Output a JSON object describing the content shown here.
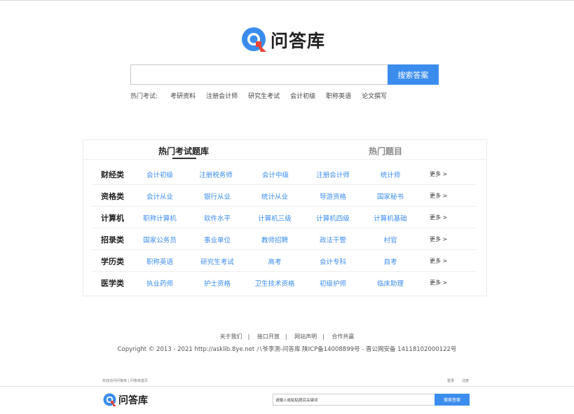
{
  "brand": {
    "name": "问答库"
  },
  "search": {
    "placeholder": "",
    "button": "搜索答案"
  },
  "hot": {
    "label": "热门考试:",
    "links": [
      "考研资料",
      "注册会计师",
      "研究生考试",
      "会计初级",
      "职称英语",
      "论文撰写"
    ]
  },
  "tabs": {
    "active": "热门考试题库",
    "inactive": "热门题目"
  },
  "categories": [
    {
      "name": "财经类",
      "items": [
        "会计初级",
        "注册税务师",
        "会计中级",
        "注册会计师",
        "统计师"
      ]
    },
    {
      "name": "资格类",
      "items": [
        "会计从业",
        "银行从业",
        "统计从业",
        "导游资格",
        "国家秘书"
      ]
    },
    {
      "name": "计算机",
      "items": [
        "职称计算机",
        "软件水平",
        "计算机三级",
        "计算机四级",
        "计算机基础"
      ]
    },
    {
      "name": "招录类",
      "items": [
        "国家公务员",
        "事业单位",
        "教师招聘",
        "政法干警",
        "村官"
      ]
    },
    {
      "name": "学历类",
      "items": [
        "职称英语",
        "研究生考试",
        "高考",
        "会计专科",
        "自考"
      ]
    },
    {
      "name": "医学类",
      "items": [
        "执业药师",
        "护士资格",
        "卫生技术资格",
        "初级护师",
        "临床助理"
      ]
    }
  ],
  "more_label": "更多 >",
  "footer": {
    "links": [
      "关于我们",
      "接口开放",
      "网站声明",
      "合作共赢"
    ],
    "separator": "|",
    "copyright": "Copyright © 2013 - 2021 http://asklib.8ye.net  八爷李测-问答库   陕ICP备14008899号 - 晋公网安备 14118102000122号"
  },
  "bottom_bar": {
    "tiny_left": "欢迎访问问答库 | 问答库首页",
    "tiny_right": [
      "登录",
      "注册"
    ],
    "search_placeholder": "请输入或粘贴题目关键词",
    "search_button": "搜索答案"
  },
  "colors": {
    "accent": "#3b8ded",
    "logo_red": "#e8443a"
  }
}
